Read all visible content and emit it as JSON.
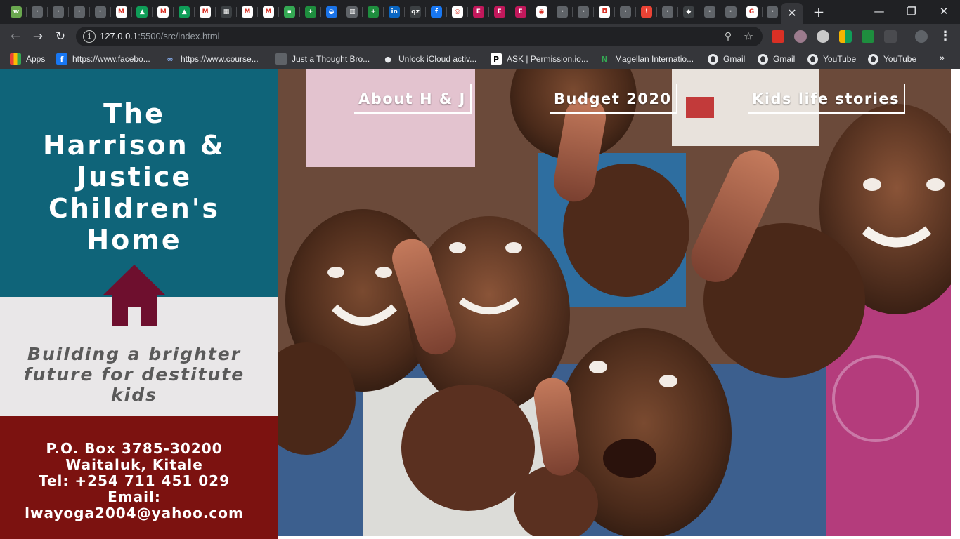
{
  "browser": {
    "active_tab_close": "✕",
    "new_tab": "+",
    "window_controls": {
      "minimize": "—",
      "restore": "❐",
      "close": "✕"
    },
    "url_host": "127.0.0.1",
    "url_rest": ":5500/src/index.html",
    "bookmarks": [
      {
        "label": "Apps",
        "icon": "apps-grid-icon"
      },
      {
        "label": "https://www.facebo...",
        "icon": "facebook-icon"
      },
      {
        "label": "https://www.course...",
        "icon": "coursera-icon"
      },
      {
        "label": "Just a Thought Bro...",
        "icon": "page-icon"
      },
      {
        "label": "Unlock iCloud activ...",
        "icon": "apple-icon"
      },
      {
        "label": "ASK | Permission.io...",
        "icon": "permission-icon"
      },
      {
        "label": "Magellan Internatio...",
        "icon": "magellan-icon"
      },
      {
        "label": "Gmail",
        "icon": "globe-icon"
      },
      {
        "label": "Gmail",
        "icon": "globe-icon"
      },
      {
        "label": "YouTube",
        "icon": "globe-icon"
      },
      {
        "label": "YouTube",
        "icon": "globe-icon"
      }
    ],
    "bookmarks_more": "»"
  },
  "site": {
    "title_lines": [
      "The",
      "Harrison &",
      "Justice",
      "Children's",
      "Home"
    ],
    "tagline_lines": [
      "Building a brighter",
      "future for destitute kids"
    ],
    "contact_lines": [
      "P.O. Box 3785-30200",
      "Waitaluk, Kitale",
      "Tel: +254 711 451 029",
      "Email:",
      "lwayoga2004@yahoo.com"
    ],
    "nav": [
      "About H & J",
      "Budget 2020",
      "Kids life stories"
    ]
  },
  "colors": {
    "teal_panel": "#0f6479",
    "light_panel": "#e9e7e8",
    "red_panel": "#7c1210",
    "house": "#6e0f2e"
  }
}
